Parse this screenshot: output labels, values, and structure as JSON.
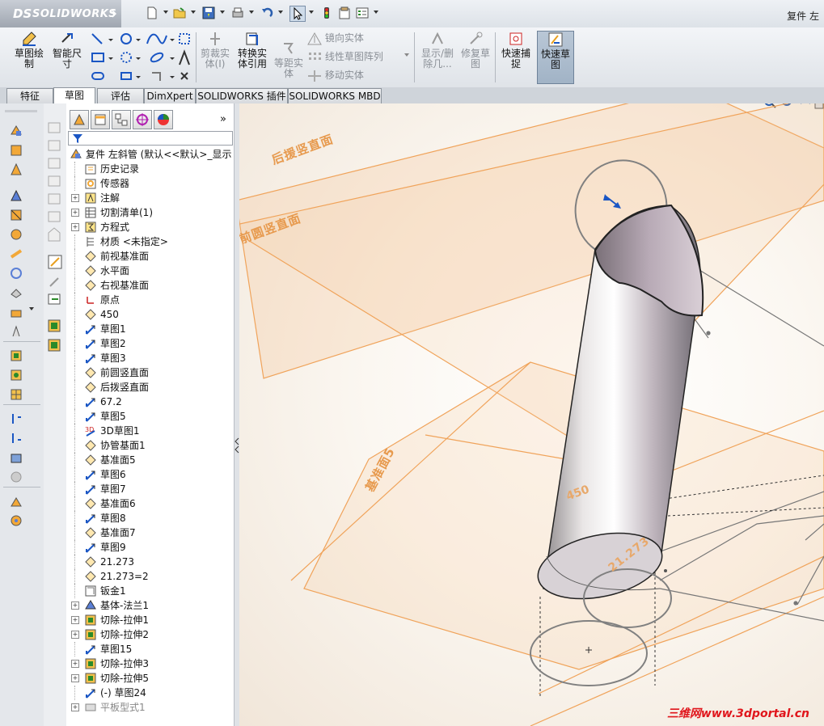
{
  "app": {
    "logo_ds": "DS",
    "logo_name": "SOLIDWORKS",
    "document_title": "复件 左"
  },
  "commands": {
    "sketch": "草图绘\n制",
    "smart_dim": "智能尺\n寸",
    "trim": "剪裁实\n体(I)",
    "convert": "转换实\n体引用",
    "offset": "等距实\n体",
    "mirror": "镜向实体",
    "linear_pattern": "线性草图阵列",
    "move": "移动实体",
    "show_delete": "显示/删\n除几...",
    "repair": "修复草\n图",
    "quick_snap": "快速捕\n捉",
    "rapid_sketch": "快速草\n图"
  },
  "tabs": [
    "特征",
    "草图",
    "评估",
    "DimXpert",
    "SOLIDWORKS 插件",
    "SOLIDWORKS MBD"
  ],
  "selected_tab": "草图",
  "tree": {
    "root": "复件 左斜管  (默认<<默认>_显示",
    "items": [
      {
        "label": "历史记录",
        "icon": "history-icon",
        "exp": false
      },
      {
        "label": "传感器",
        "icon": "sensor-icon",
        "exp": false
      },
      {
        "label": "注解",
        "icon": "annotation-icon",
        "exp": true
      },
      {
        "label": "切割清单(1)",
        "icon": "cut-list-icon",
        "exp": true
      },
      {
        "label": "方程式",
        "icon": "equation-icon",
        "exp": true
      },
      {
        "label": "材质 <未指定>",
        "icon": "material-icon",
        "exp": false
      },
      {
        "label": "前视基准面",
        "icon": "plane-icon",
        "exp": false
      },
      {
        "label": "水平面",
        "icon": "plane-icon",
        "exp": false
      },
      {
        "label": "右视基准面",
        "icon": "plane-icon",
        "exp": false
      },
      {
        "label": "原点",
        "icon": "origin-icon",
        "exp": false
      },
      {
        "label": "450",
        "icon": "plane-icon",
        "exp": false
      },
      {
        "label": "草图1",
        "icon": "sketch-icon",
        "exp": false
      },
      {
        "label": "草图2",
        "icon": "sketch-icon",
        "exp": false
      },
      {
        "label": "草图3",
        "icon": "sketch-icon",
        "exp": false
      },
      {
        "label": "前圆竖直面",
        "icon": "plane-icon",
        "exp": false
      },
      {
        "label": "后拨竖直面",
        "icon": "plane-icon",
        "exp": false
      },
      {
        "label": "67.2",
        "icon": "sketch-icon",
        "exp": false
      },
      {
        "label": "草图5",
        "icon": "sketch-icon",
        "exp": false
      },
      {
        "label": "3D草图1",
        "icon": "sketch3d-icon",
        "exp": false
      },
      {
        "label": "协管基面1",
        "icon": "plane-icon",
        "exp": false
      },
      {
        "label": "基准面5",
        "icon": "plane-icon",
        "exp": false
      },
      {
        "label": "草图6",
        "icon": "sketch-icon",
        "exp": false
      },
      {
        "label": "草图7",
        "icon": "sketch-icon",
        "exp": false
      },
      {
        "label": "基准面6",
        "icon": "plane-icon",
        "exp": false
      },
      {
        "label": "草图8",
        "icon": "sketch-icon",
        "exp": false
      },
      {
        "label": "基准面7",
        "icon": "plane-icon",
        "exp": false
      },
      {
        "label": "草图9",
        "icon": "sketch-icon",
        "exp": false
      },
      {
        "label": "21.273",
        "icon": "plane-icon",
        "exp": false
      },
      {
        "label": "21.273=2",
        "icon": "plane-icon",
        "exp": false
      },
      {
        "label": "钣金1",
        "icon": "sheetmetal-icon",
        "exp": false
      },
      {
        "label": "基体-法兰1",
        "icon": "flange-icon",
        "exp": true
      },
      {
        "label": "切除-拉伸1",
        "icon": "cut-extrude-icon",
        "exp": true
      },
      {
        "label": "切除-拉伸2",
        "icon": "cut-extrude-icon",
        "exp": true
      },
      {
        "label": "草图15",
        "icon": "sketch-icon",
        "exp": false
      },
      {
        "label": "切除-拉伸3",
        "icon": "cut-extrude-icon",
        "exp": true
      },
      {
        "label": "切除-拉伸5",
        "icon": "cut-extrude-icon",
        "exp": true
      },
      {
        "label": "(-) 草图24",
        "icon": "sketch-icon",
        "exp": false
      },
      {
        "label": "平板型式1",
        "icon": "flat-pattern-icon",
        "exp": true,
        "grey": true
      }
    ]
  },
  "viewport": {
    "plane_labels": {
      "back": "后援竖直面",
      "front": "前圆竖直面",
      "datum5": "基准面5"
    },
    "dims": {
      "d450": "450",
      "d21": "21.273"
    }
  },
  "watermark": "三维网www.3dportal.cn",
  "colors": {
    "plane_stroke": "#f0a35a",
    "plane_fill": "#f6c89a",
    "plane_label": "#e79a4e",
    "watermark": "#e0161c"
  }
}
